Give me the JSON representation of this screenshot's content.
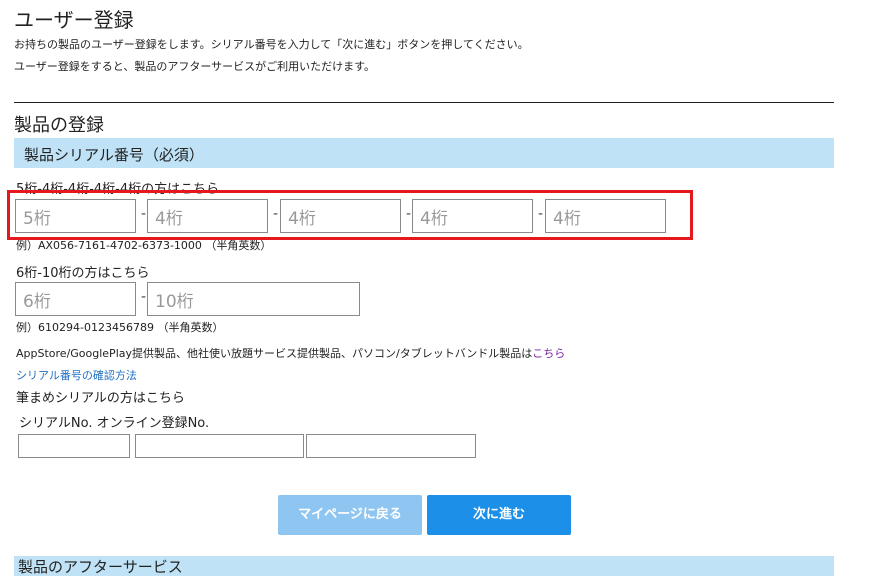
{
  "page": {
    "title": "ユーザー登録",
    "intro_line1": "お持ちの製品のユーザー登録をします。シリアル番号を入力して「次に進む」ボタンを押してください。",
    "intro_line2": "ユーザー登録をすると、製品のアフターサービスがご利用いただけます。"
  },
  "registration": {
    "section_title": "製品の登録",
    "serial_header": "製品シリアル番号（必須）",
    "format_a": {
      "label": "5桁-4桁-4桁-4桁-4桁の方はこちら",
      "placeholders": [
        "5桁",
        "4桁",
        "4桁",
        "4桁",
        "4桁"
      ],
      "separator": "-",
      "example": "例）AX056-7161-4702-6373-1000 （半角英数）"
    },
    "format_b": {
      "label": "6桁-10桁の方はこちら",
      "placeholders": [
        "6桁",
        "10桁"
      ],
      "separator": "-",
      "example": "例）610294-0123456789 （半角英数）"
    },
    "appstore_text": "AppStore/GooglePlay提供製品、他社使い放題サービス提供製品、パソコン/タブレットバンドル製品は",
    "appstore_link": "こちら",
    "serial_check_link": "シリアル番号の確認方法",
    "fude_label": "筆まめシリアルの方はこちら",
    "fude_columns": "シリアルNo. オンライン登録No."
  },
  "buttons": {
    "back": "マイページに戻る",
    "next": "次に進む"
  },
  "after_service": {
    "title": "製品のアフターサービス"
  },
  "colors": {
    "section_bar": "#bfe2f6",
    "highlight_border": "#e5191d",
    "button_primary": "#1c8fe8",
    "button_secondary": "#8fc6f1",
    "link": "#1f6fc4"
  }
}
